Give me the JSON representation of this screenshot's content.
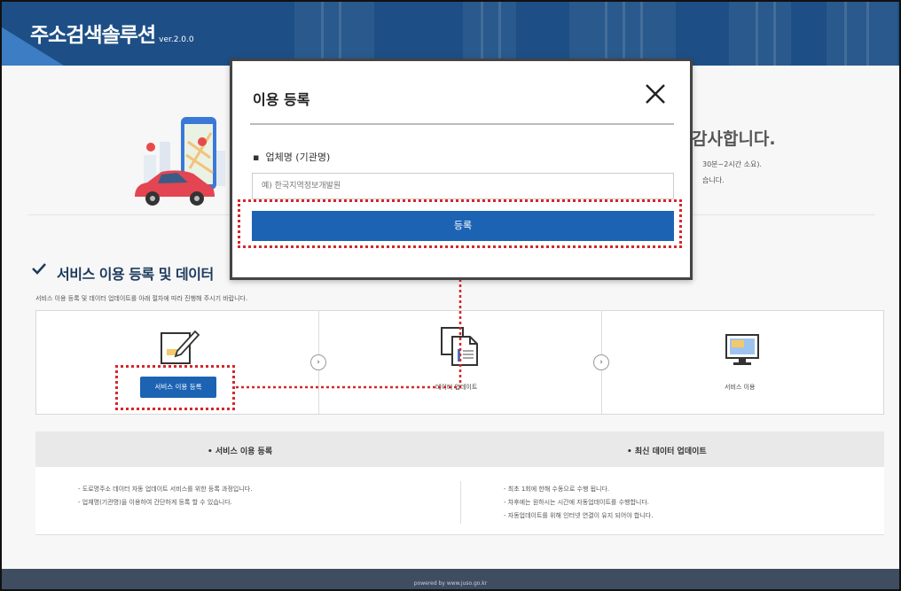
{
  "header": {
    "brand": "주소검색솔루션",
    "version": "ver.2.0.0"
  },
  "hero": {
    "title": "감사합니다.",
    "sub1": "30분~2시간 소요).",
    "sub2": "습니다."
  },
  "section": {
    "title": "서비스 이용 등록 및 데이터",
    "desc": "서비스 이용 등록 및 데이터 업데이트를 아래 절차에 따라 진행해 주시기 바랍니다."
  },
  "steps": [
    {
      "label": "서비스 이용 등록",
      "icon": "edit-document-icon"
    },
    {
      "label": "데이터 업데이트",
      "icon": "documents-icon"
    },
    {
      "label": "서비스 이용",
      "icon": "monitor-icon"
    }
  ],
  "info": {
    "left": {
      "title": "• 서비스 이용 등록",
      "lines": [
        "- 도로명주소 데이터 자동 업데이트 서비스를 위한 등록 과정입니다.",
        "- 업체명(기관명)을 이용하여 간단하게 등록 할 수 있습니다."
      ]
    },
    "right": {
      "title": "• 최신 데이터 업데이트",
      "lines": [
        "- 최초 1회에 한해 수동으로 수행 됩니다.",
        "- 차후에는 원하시는 시간에 자동업데이트를 수행합니다.",
        "- 자동업데이트를 위해 인터넷 연결이 유지 되어야 합니다."
      ]
    }
  },
  "footer": {
    "text": "powered by www.juso.go.kr"
  },
  "modal": {
    "title": "이용 등록",
    "field_label": "업체명 (기관명)",
    "placeholder": "예) 한국지역정보개발원",
    "submit": "등록"
  },
  "colors": {
    "primary": "#1c63b4",
    "header": "#1d4f86",
    "highlight": "#d7262a"
  }
}
